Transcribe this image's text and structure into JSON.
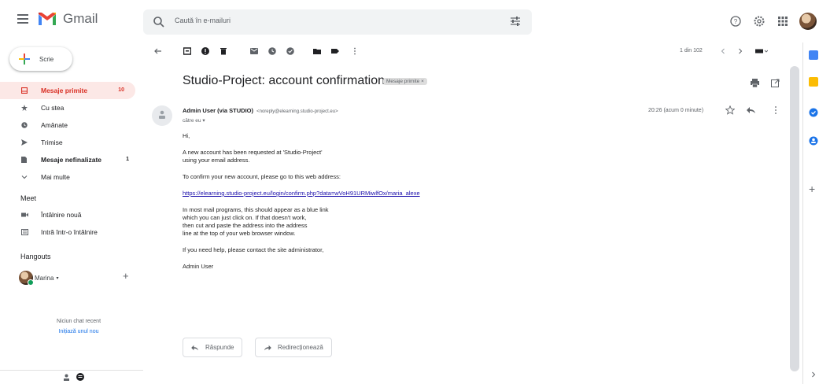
{
  "app": {
    "name": "Gmail"
  },
  "search": {
    "placeholder": "Caută în e-mailuri"
  },
  "compose": {
    "label": "Scrie"
  },
  "nav": {
    "items": [
      {
        "label": "Mesaje primite",
        "count": "10",
        "icon": "inbox-icon"
      },
      {
        "label": "Cu stea",
        "count": "",
        "icon": "star-icon"
      },
      {
        "label": "Amânate",
        "count": "",
        "icon": "clock-icon"
      },
      {
        "label": "Trimise",
        "count": "",
        "icon": "send-icon"
      },
      {
        "label": "Mesaje nefinalizate",
        "count": "1",
        "icon": "draft-icon"
      },
      {
        "label": "Mai multe",
        "count": "",
        "icon": "chevron-down-icon"
      }
    ]
  },
  "meet": {
    "title": "Meet",
    "new_meeting": "Întâlnire nouă",
    "join_meeting": "Intră într-o întâlnire"
  },
  "hangouts": {
    "title": "Hangouts",
    "user": "Marina",
    "no_chat": "Niciun chat recent",
    "start_new": "Inițiază unul nou"
  },
  "pager": {
    "text": "1 din 102"
  },
  "message": {
    "subject": "Studio-Project: account confirmation",
    "label_chip": "Mesaje primite ×",
    "sender_name": "Admin User (via STUDIO)",
    "sender_email": "<noreply@elearning.studio-project.eu>",
    "to": "către eu",
    "time": "20:26 (acum 0 minute)",
    "greeting": "Hi,",
    "para1_line1": "A new account has been requested at 'Studio-Project'",
    "para1_line2": "using your email address.",
    "para2": "To confirm your new account, please go to this web address:",
    "link": "https://elearning.studio-project.eu/login/confirm.php?data=wVoH91URMiwlfOx/maria_alexe",
    "para3_line1": "In most mail programs, this should appear as a blue link",
    "para3_line2": "which you can just click on.  If that doesn't work,",
    "para3_line3": "then cut and paste the address into the address",
    "para3_line4": "line at the top of your web browser window.",
    "para4": "If you need help, please contact the site administrator,",
    "signature": "Admin User"
  },
  "actions": {
    "reply": "Răspunde",
    "forward": "Redirecționează"
  },
  "colors": {
    "accent_red": "#d93025",
    "active_bg": "#fce8e6",
    "link": "#1a0dab",
    "blue": "#1a73e8"
  }
}
